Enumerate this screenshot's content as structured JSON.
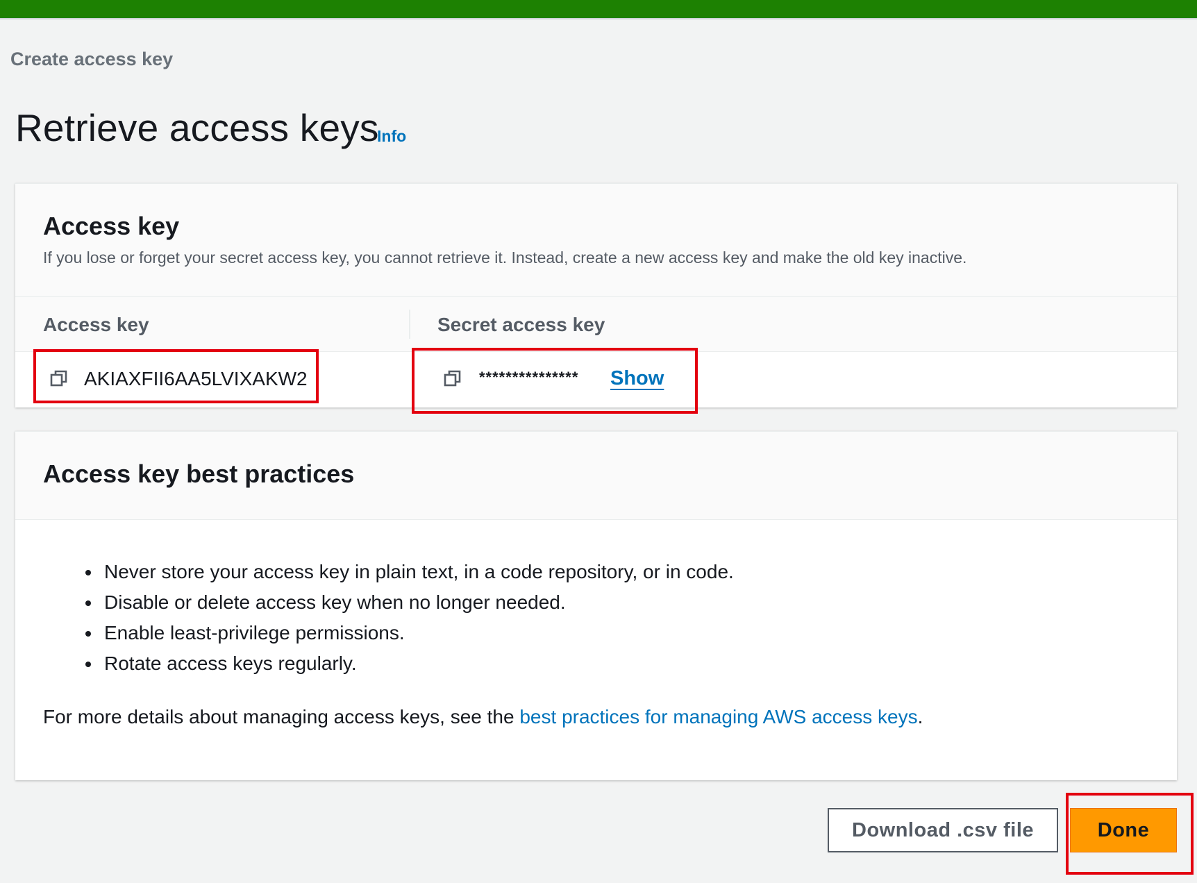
{
  "breadcrumb": {
    "label": "Create access key"
  },
  "page": {
    "title": "Retrieve access keys",
    "info_label": "Info"
  },
  "access_key_panel": {
    "heading": "Access key",
    "description": "If you lose or forget your secret access key, you cannot retrieve it. Instead, create a new access key and make the old key inactive.",
    "columns": [
      "Access key",
      "Secret access key"
    ],
    "access_key_value": "AKIAXFII6AA5LVIXAKW2",
    "secret_key_masked": "***************",
    "show_label": "Show",
    "copy_icon": "copy-icon"
  },
  "best_practices_panel": {
    "heading": "Access key best practices",
    "items": [
      "Never store your access key in plain text, in a code repository, or in code.",
      "Disable or delete access key when no longer needed.",
      "Enable least-privilege permissions.",
      "Rotate access keys regularly."
    ],
    "more_prefix": "For more details about managing access keys, see the ",
    "more_link": "best practices for managing AWS access keys",
    "more_suffix": "."
  },
  "actions": {
    "download_label": "Download .csv file",
    "done_label": "Done"
  },
  "colors": {
    "top_bar": "#1d8102",
    "link": "#0073bb",
    "primary_button": "#ff9900",
    "highlight": "#e3000f"
  }
}
